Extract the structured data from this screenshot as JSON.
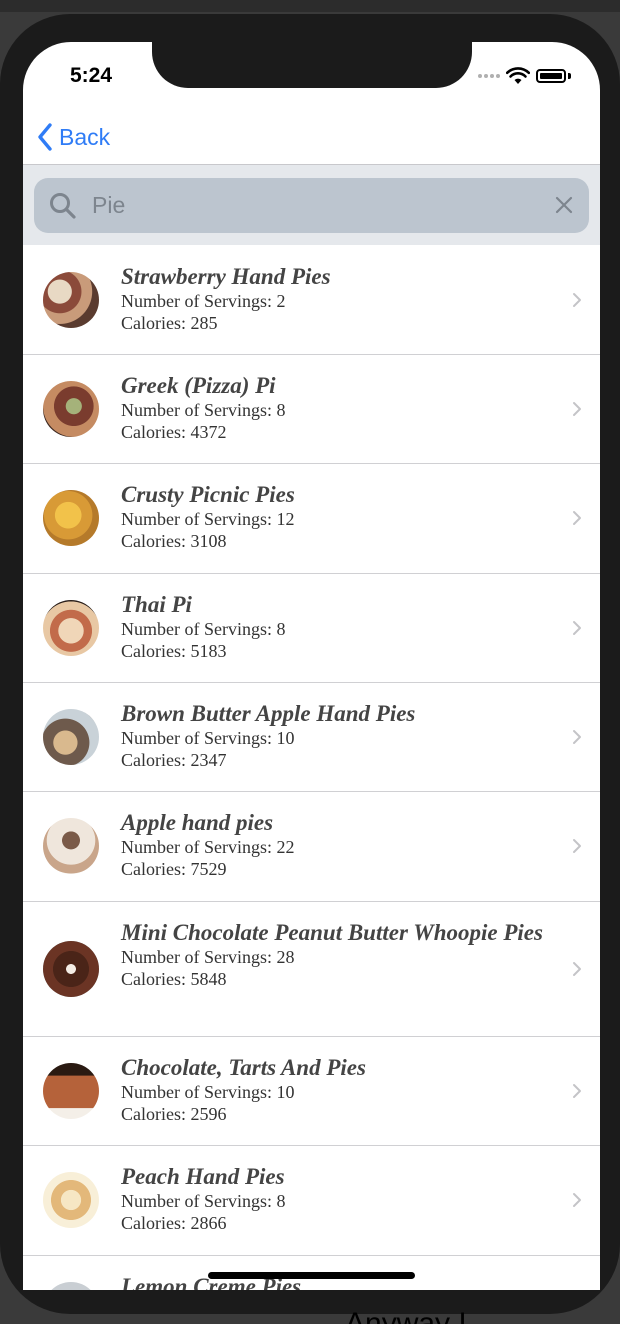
{
  "status": {
    "time": "5:24"
  },
  "nav": {
    "back_label": "Back"
  },
  "search": {
    "value": "Pie",
    "placeholder": ""
  },
  "recipes": [
    {
      "title": "Strawberry Hand Pies",
      "servings": "Number of Servings: 2",
      "calories": "Calories: 285"
    },
    {
      "title": "Greek (Pizza) Pi",
      "servings": "Number of Servings: 8",
      "calories": "Calories: 4372"
    },
    {
      "title": "Crusty Picnic Pies",
      "servings": "Number of Servings: 12",
      "calories": "Calories: 3108"
    },
    {
      "title": "Thai Pi",
      "servings": "Number of Servings: 8",
      "calories": "Calories: 5183"
    },
    {
      "title": "Brown Butter Apple Hand Pies",
      "servings": "Number of Servings: 10",
      "calories": "Calories: 2347"
    },
    {
      "title": "Apple hand pies",
      "servings": "Number of Servings: 22",
      "calories": "Calories: 7529"
    },
    {
      "title": "Mini Chocolate Peanut Butter Whoopie Pies",
      "servings": "Number of Servings: 28",
      "calories": "Calories: 5848"
    },
    {
      "title": "Chocolate, Tarts And Pies",
      "servings": "Number of Servings: 10",
      "calories": "Calories: 2596"
    },
    {
      "title": "Peach Hand Pies",
      "servings": "Number of Servings: 8",
      "calories": "Calories: 2866"
    },
    {
      "title": "Lemon Creme Pies",
      "servings": "",
      "calories": ""
    }
  ],
  "background_text": "Anyway I",
  "colors": {
    "accent": "#2f7cf6",
    "search_bg": "#e5e8ec",
    "field_bg": "#bcc5cf"
  }
}
